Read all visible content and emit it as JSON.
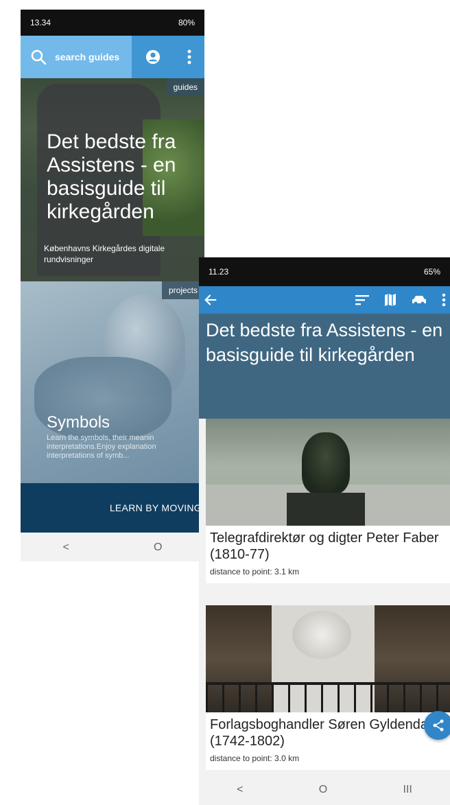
{
  "phone1": {
    "status": {
      "time": "13.34",
      "battery": "80%"
    },
    "search": {
      "placeholder": "search guides"
    },
    "card1": {
      "tag": "guides",
      "title": "Det bedste fra Assistens - en basisguide til kirkegården",
      "subtitle": "Københavns Kirkegårdes digitale rundvisninger"
    },
    "card2": {
      "tag": "projects",
      "title": "Symbols",
      "description": "Learn the symbols, their meanin\ninterpretations.Enjoy explanation\ninterpretations of symb..."
    },
    "banner": "LEARN BY MOVING",
    "nav": {
      "back": "<",
      "home": "O"
    }
  },
  "phone2": {
    "status": {
      "time": "11.23",
      "battery": "65%"
    },
    "header_title": "Det bedste fra Assistens - en basisguide til kirkegården",
    "items": [
      {
        "title": "Telegrafdirektør og digter Peter Faber (1810-77)",
        "distance": "distance to point: 3.1 km"
      },
      {
        "title": "Forlagsboghandler Søren Gyldendal (1742-1802)",
        "distance": "distance to point: 3.0 km"
      }
    ],
    "nav": {
      "back": "<",
      "home": "O",
      "recents": "III"
    }
  },
  "colors": {
    "toolbar": "#2f86c9",
    "header": "#3f6782",
    "banner": "#0f3d5f",
    "search": "#73b9ea"
  },
  "icons": [
    "search-icon",
    "account-icon",
    "more-vertical-icon",
    "back-arrow-icon",
    "sort-icon",
    "map-icon",
    "car-icon",
    "share-icon"
  ]
}
